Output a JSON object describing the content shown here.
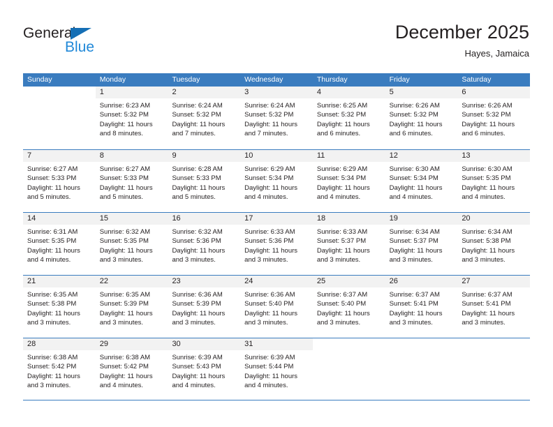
{
  "brand": {
    "name_dark": "General",
    "name_blue": "Blue",
    "accent_color": "#156FB5",
    "blue_text_color": "#2088d8"
  },
  "header": {
    "title": "December 2025",
    "subtitle": "Hayes, Jamaica"
  },
  "calendar": {
    "header_bg": "#3A7CBF",
    "day_band_bg": "#f2f2f2",
    "weekdays": [
      "Sunday",
      "Monday",
      "Tuesday",
      "Wednesday",
      "Thursday",
      "Friday",
      "Saturday"
    ],
    "weeks": [
      [
        {
          "day": "",
          "sunrise": "",
          "sunset": "",
          "daylight": "",
          "empty": true
        },
        {
          "day": "1",
          "sunrise": "Sunrise: 6:23 AM",
          "sunset": "Sunset: 5:32 PM",
          "daylight": "Daylight: 11 hours and 8 minutes."
        },
        {
          "day": "2",
          "sunrise": "Sunrise: 6:24 AM",
          "sunset": "Sunset: 5:32 PM",
          "daylight": "Daylight: 11 hours and 7 minutes."
        },
        {
          "day": "3",
          "sunrise": "Sunrise: 6:24 AM",
          "sunset": "Sunset: 5:32 PM",
          "daylight": "Daylight: 11 hours and 7 minutes."
        },
        {
          "day": "4",
          "sunrise": "Sunrise: 6:25 AM",
          "sunset": "Sunset: 5:32 PM",
          "daylight": "Daylight: 11 hours and 6 minutes."
        },
        {
          "day": "5",
          "sunrise": "Sunrise: 6:26 AM",
          "sunset": "Sunset: 5:32 PM",
          "daylight": "Daylight: 11 hours and 6 minutes."
        },
        {
          "day": "6",
          "sunrise": "Sunrise: 6:26 AM",
          "sunset": "Sunset: 5:32 PM",
          "daylight": "Daylight: 11 hours and 6 minutes."
        }
      ],
      [
        {
          "day": "7",
          "sunrise": "Sunrise: 6:27 AM",
          "sunset": "Sunset: 5:33 PM",
          "daylight": "Daylight: 11 hours and 5 minutes."
        },
        {
          "day": "8",
          "sunrise": "Sunrise: 6:27 AM",
          "sunset": "Sunset: 5:33 PM",
          "daylight": "Daylight: 11 hours and 5 minutes."
        },
        {
          "day": "9",
          "sunrise": "Sunrise: 6:28 AM",
          "sunset": "Sunset: 5:33 PM",
          "daylight": "Daylight: 11 hours and 5 minutes."
        },
        {
          "day": "10",
          "sunrise": "Sunrise: 6:29 AM",
          "sunset": "Sunset: 5:34 PM",
          "daylight": "Daylight: 11 hours and 4 minutes."
        },
        {
          "day": "11",
          "sunrise": "Sunrise: 6:29 AM",
          "sunset": "Sunset: 5:34 PM",
          "daylight": "Daylight: 11 hours and 4 minutes."
        },
        {
          "day": "12",
          "sunrise": "Sunrise: 6:30 AM",
          "sunset": "Sunset: 5:34 PM",
          "daylight": "Daylight: 11 hours and 4 minutes."
        },
        {
          "day": "13",
          "sunrise": "Sunrise: 6:30 AM",
          "sunset": "Sunset: 5:35 PM",
          "daylight": "Daylight: 11 hours and 4 minutes."
        }
      ],
      [
        {
          "day": "14",
          "sunrise": "Sunrise: 6:31 AM",
          "sunset": "Sunset: 5:35 PM",
          "daylight": "Daylight: 11 hours and 4 minutes."
        },
        {
          "day": "15",
          "sunrise": "Sunrise: 6:32 AM",
          "sunset": "Sunset: 5:35 PM",
          "daylight": "Daylight: 11 hours and 3 minutes."
        },
        {
          "day": "16",
          "sunrise": "Sunrise: 6:32 AM",
          "sunset": "Sunset: 5:36 PM",
          "daylight": "Daylight: 11 hours and 3 minutes."
        },
        {
          "day": "17",
          "sunrise": "Sunrise: 6:33 AM",
          "sunset": "Sunset: 5:36 PM",
          "daylight": "Daylight: 11 hours and 3 minutes."
        },
        {
          "day": "18",
          "sunrise": "Sunrise: 6:33 AM",
          "sunset": "Sunset: 5:37 PM",
          "daylight": "Daylight: 11 hours and 3 minutes."
        },
        {
          "day": "19",
          "sunrise": "Sunrise: 6:34 AM",
          "sunset": "Sunset: 5:37 PM",
          "daylight": "Daylight: 11 hours and 3 minutes."
        },
        {
          "day": "20",
          "sunrise": "Sunrise: 6:34 AM",
          "sunset": "Sunset: 5:38 PM",
          "daylight": "Daylight: 11 hours and 3 minutes."
        }
      ],
      [
        {
          "day": "21",
          "sunrise": "Sunrise: 6:35 AM",
          "sunset": "Sunset: 5:38 PM",
          "daylight": "Daylight: 11 hours and 3 minutes."
        },
        {
          "day": "22",
          "sunrise": "Sunrise: 6:35 AM",
          "sunset": "Sunset: 5:39 PM",
          "daylight": "Daylight: 11 hours and 3 minutes."
        },
        {
          "day": "23",
          "sunrise": "Sunrise: 6:36 AM",
          "sunset": "Sunset: 5:39 PM",
          "daylight": "Daylight: 11 hours and 3 minutes."
        },
        {
          "day": "24",
          "sunrise": "Sunrise: 6:36 AM",
          "sunset": "Sunset: 5:40 PM",
          "daylight": "Daylight: 11 hours and 3 minutes."
        },
        {
          "day": "25",
          "sunrise": "Sunrise: 6:37 AM",
          "sunset": "Sunset: 5:40 PM",
          "daylight": "Daylight: 11 hours and 3 minutes."
        },
        {
          "day": "26",
          "sunrise": "Sunrise: 6:37 AM",
          "sunset": "Sunset: 5:41 PM",
          "daylight": "Daylight: 11 hours and 3 minutes."
        },
        {
          "day": "27",
          "sunrise": "Sunrise: 6:37 AM",
          "sunset": "Sunset: 5:41 PM",
          "daylight": "Daylight: 11 hours and 3 minutes."
        }
      ],
      [
        {
          "day": "28",
          "sunrise": "Sunrise: 6:38 AM",
          "sunset": "Sunset: 5:42 PM",
          "daylight": "Daylight: 11 hours and 3 minutes."
        },
        {
          "day": "29",
          "sunrise": "Sunrise: 6:38 AM",
          "sunset": "Sunset: 5:42 PM",
          "daylight": "Daylight: 11 hours and 4 minutes."
        },
        {
          "day": "30",
          "sunrise": "Sunrise: 6:39 AM",
          "sunset": "Sunset: 5:43 PM",
          "daylight": "Daylight: 11 hours and 4 minutes."
        },
        {
          "day": "31",
          "sunrise": "Sunrise: 6:39 AM",
          "sunset": "Sunset: 5:44 PM",
          "daylight": "Daylight: 11 hours and 4 minutes."
        },
        {
          "day": "",
          "sunrise": "",
          "sunset": "",
          "daylight": "",
          "empty": true
        },
        {
          "day": "",
          "sunrise": "",
          "sunset": "",
          "daylight": "",
          "empty": true
        },
        {
          "day": "",
          "sunrise": "",
          "sunset": "",
          "daylight": "",
          "empty": true
        }
      ]
    ]
  }
}
